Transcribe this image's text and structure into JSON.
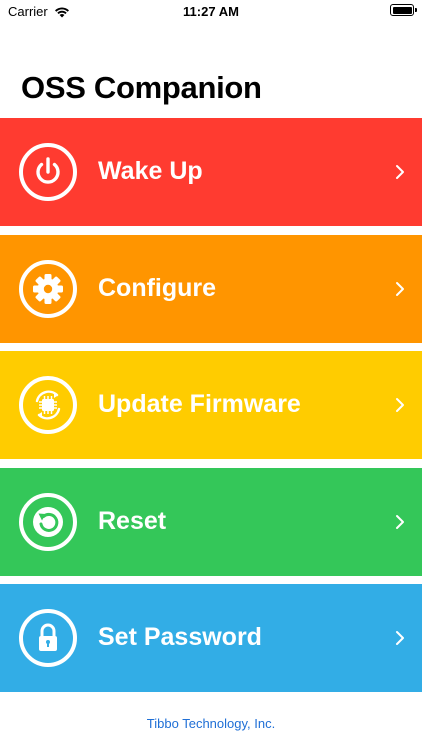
{
  "status_bar": {
    "carrier": "Carrier",
    "time": "11:27 AM"
  },
  "title": "OSS Companion",
  "menu": [
    {
      "label": "Wake Up",
      "color": "#ff3b30",
      "icon": "power-icon"
    },
    {
      "label": "Configure",
      "color": "#ff9500",
      "icon": "gear-icon"
    },
    {
      "label": "Update Firmware",
      "color": "#ffcc00",
      "icon": "chip-sync-icon"
    },
    {
      "label": "Reset",
      "color": "#34c759",
      "icon": "reset-icon"
    },
    {
      "label": "Set Password",
      "color": "#32ade6",
      "icon": "lock-icon"
    }
  ],
  "footer": "Tibbo Technology, Inc."
}
